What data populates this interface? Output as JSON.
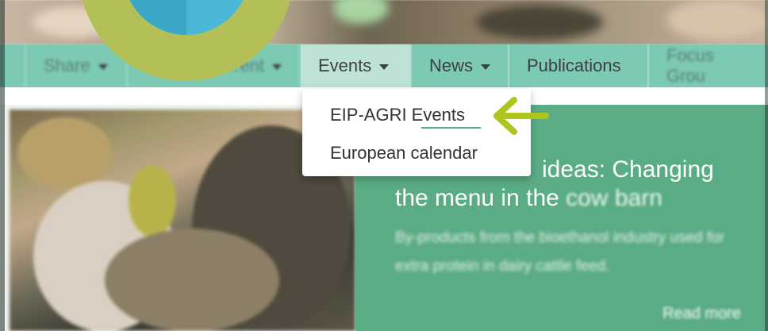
{
  "nav": {
    "items": [
      {
        "label": "Share",
        "has_caret": true
      },
      {
        "label": "…ent",
        "has_caret": true
      },
      {
        "label": "Events",
        "has_caret": true
      },
      {
        "label": "News",
        "has_caret": true
      },
      {
        "label": "Publications",
        "has_caret": false
      },
      {
        "label": "Focus Grou",
        "has_caret": false
      }
    ]
  },
  "dropdown": {
    "items": [
      "EIP-AGRI Events",
      "European calendar"
    ]
  },
  "feature": {
    "title_line1_visible": "ideas: Changing",
    "title_line2_visible": "the menu in the",
    "title_line2_blurred": "cow barn",
    "description": "By-products from the bioethanol industry used for extra protein in dairy cattle feed.",
    "read_more": "Read more"
  },
  "colors": {
    "nav_bg": "#7cc9b4",
    "panel_green": "#5aac84",
    "logo_ring": "#b3c057",
    "arrow": "#b0c41e"
  },
  "icons": [
    "logo-globe-icon",
    "caret-down-icon",
    "arrow-left-icon"
  ]
}
